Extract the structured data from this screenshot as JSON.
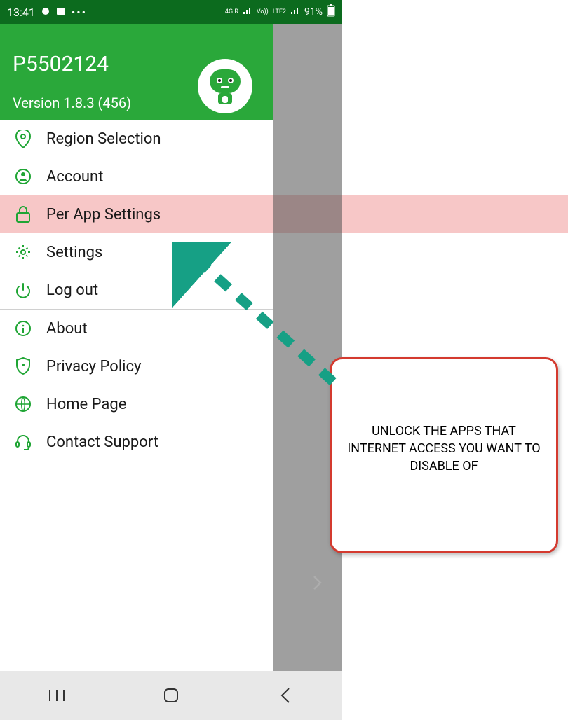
{
  "statusbar": {
    "time": "13:41",
    "network_label": "4G R",
    "lte_label": "LTE2",
    "volte_label": "Vo))",
    "battery": "91%"
  },
  "header": {
    "username": "P5502124",
    "version": "Version 1.8.3 (456)"
  },
  "menu": {
    "section1": [
      {
        "label": "Region Selection"
      },
      {
        "label": "Account"
      },
      {
        "label": "Per App Settings"
      },
      {
        "label": "Settings"
      },
      {
        "label": "Log out"
      }
    ],
    "section2": [
      {
        "label": "About"
      },
      {
        "label": "Privacy Policy"
      },
      {
        "label": "Home Page"
      },
      {
        "label": "Contact Support"
      }
    ]
  },
  "callout": {
    "text": "UNLOCK THE APPS THAT INTERNET ACCESS YOU WANT TO DISABLE OF"
  }
}
